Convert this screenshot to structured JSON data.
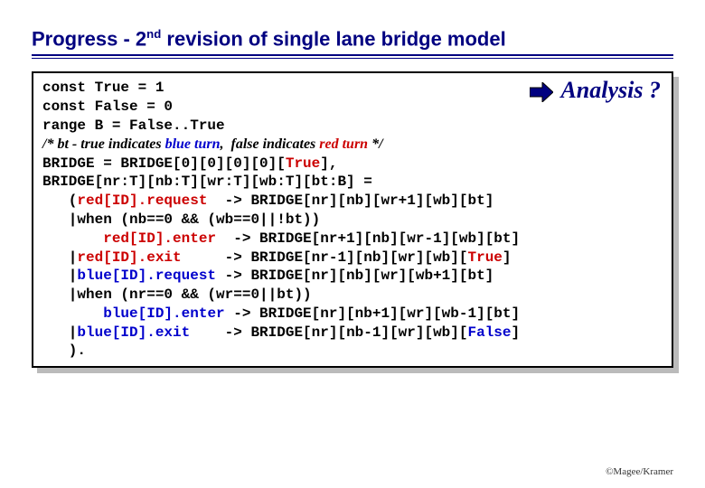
{
  "title": {
    "pre": "Progress - 2",
    "sup": "nd",
    "post": " revision of single lane bridge model"
  },
  "analysis_label": "Analysis ?",
  "code": {
    "l1": "const True = 1",
    "l2": "const False = 0",
    "l3": "range B = False..True",
    "comment": {
      "p1": "/* ",
      "bt": "bt",
      "p2": " - true indicates ",
      "bt_blue": "blue turn",
      "p3": ",  false indicates ",
      "bt_red": "red turn",
      "p4": " */"
    },
    "l5a": "BRIDGE = BRIDGE[0][0][0][0][",
    "l5b": "True",
    "l5c": "],",
    "l6": "BRIDGE[nr:T][nb:T][wr:T][wb:T][bt:B] =",
    "l7a": "   (",
    "l7r": "red[ID].request",
    "l7b": "  -> BRIDGE[nr][nb][wr+1][wb][bt]",
    "l8": "   |when (nb==0 && (wb==0||!bt))",
    "l9a": "       ",
    "l9r": "red[ID].enter",
    "l9b": "  -> BRIDGE[nr+1][nb][wr-1][wb][bt]",
    "l10a": "   |",
    "l10r": "red[ID].exit",
    "l10b": "     -> BRIDGE[nr-1][nb][wr][wb][",
    "l10t": "True",
    "l10c": "]",
    "l11a": "   |",
    "l11bl": "blue[ID].request",
    "l11b": " -> BRIDGE[nr][nb][wr][wb+1][bt]",
    "l12": "   |when (nr==0 && (wr==0||bt))",
    "l13a": "       ",
    "l13bl": "blue[ID].enter",
    "l13b": " -> BRIDGE[nr][nb+1][wr][wb-1][bt]",
    "l14a": "   |",
    "l14bl": "blue[ID].exit",
    "l14b": "    -> BRIDGE[nr][nb-1][wr][wb][",
    "l14f": "False",
    "l14c": "]",
    "l15": "   )."
  },
  "footer": "©Magee/Kramer",
  "chart_data": {
    "type": "table",
    "title": "FSP model: single lane bridge, 2nd revision",
    "constants": {
      "True": 1,
      "False": 0
    },
    "ranges": {
      "B": "False..True"
    },
    "process": "BRIDGE",
    "init": "BRIDGE[0][0][0][0][True]",
    "params": [
      "nr:T",
      "nb:T",
      "wr:T",
      "wb:T",
      "bt:B"
    ],
    "transitions": [
      {
        "action": "red[ID].request",
        "guard": null,
        "target": "BRIDGE[nr][nb][wr+1][wb][bt]"
      },
      {
        "action": "red[ID].enter",
        "guard": "nb==0 && (wb==0||!bt)",
        "target": "BRIDGE[nr+1][nb][wr-1][wb][bt]"
      },
      {
        "action": "red[ID].exit",
        "guard": null,
        "target": "BRIDGE[nr-1][nb][wr][wb][True]"
      },
      {
        "action": "blue[ID].request",
        "guard": null,
        "target": "BRIDGE[nr][nb][wr][wb+1][bt]"
      },
      {
        "action": "blue[ID].enter",
        "guard": "nr==0 && (wr==0||bt)",
        "target": "BRIDGE[nr][nb+1][wr][wb-1][bt]"
      },
      {
        "action": "blue[ID].exit",
        "guard": null,
        "target": "BRIDGE[nr][nb-1][wr][wb][False]"
      }
    ]
  }
}
